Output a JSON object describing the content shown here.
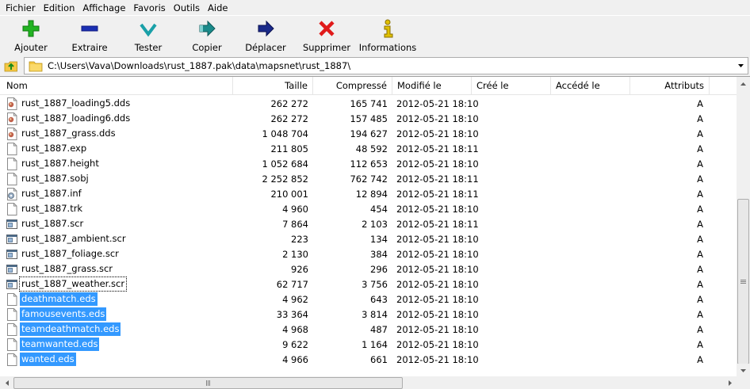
{
  "menu": [
    "Fichier",
    "Edition",
    "Affichage",
    "Favoris",
    "Outils",
    "Aide"
  ],
  "toolbar": [
    {
      "label": "Ajouter",
      "icon": "plus-icon",
      "color": "#22b322"
    },
    {
      "label": "Extraire",
      "icon": "minus-icon",
      "color": "#1a2fb3"
    },
    {
      "label": "Tester",
      "icon": "checkmark-icon",
      "color": "#1aa0a8"
    },
    {
      "label": "Copier",
      "icon": "copy-arrow-icon",
      "color": "#1a8a8a"
    },
    {
      "label": "Déplacer",
      "icon": "move-arrow-icon",
      "color": "#1a2a8a"
    },
    {
      "label": "Supprimer",
      "icon": "delete-x-icon",
      "color": "#e01a1a"
    },
    {
      "label": "Informations",
      "icon": "info-icon",
      "color": "#e0c000"
    }
  ],
  "address": {
    "path": "C:\\Users\\Vava\\Downloads\\rust_1887.pak\\data\\mapsnet\\rust_1887\\"
  },
  "columns": {
    "name": "Nom",
    "size": "Taille",
    "compressed": "Compressé",
    "modified": "Modifié le",
    "created": "Créé le",
    "accessed": "Accédé le",
    "attributes": "Attributs"
  },
  "files": [
    {
      "name": "rust_1887_loading5.dds",
      "size": "262 272",
      "compressed": "165 741",
      "modified": "2012-05-21 18:10",
      "attr": "A",
      "icon": "image-file-icon",
      "selected": false,
      "focused": false
    },
    {
      "name": "rust_1887_loading6.dds",
      "size": "262 272",
      "compressed": "157 485",
      "modified": "2012-05-21 18:10",
      "attr": "A",
      "icon": "image-file-icon",
      "selected": false,
      "focused": false
    },
    {
      "name": "rust_1887_grass.dds",
      "size": "1 048 704",
      "compressed": "194 627",
      "modified": "2012-05-21 18:10",
      "attr": "A",
      "icon": "image-file-icon",
      "selected": false,
      "focused": false
    },
    {
      "name": "rust_1887.exp",
      "size": "211 805",
      "compressed": "48 592",
      "modified": "2012-05-21 18:11",
      "attr": "A",
      "icon": "blank-file-icon",
      "selected": false,
      "focused": false
    },
    {
      "name": "rust_1887.height",
      "size": "1 052 684",
      "compressed": "112 653",
      "modified": "2012-05-21 18:10",
      "attr": "A",
      "icon": "blank-file-icon",
      "selected": false,
      "focused": false
    },
    {
      "name": "rust_1887.sobj",
      "size": "2 252 852",
      "compressed": "762 742",
      "modified": "2012-05-21 18:11",
      "attr": "A",
      "icon": "blank-file-icon",
      "selected": false,
      "focused": false
    },
    {
      "name": "rust_1887.inf",
      "size": "210 001",
      "compressed": "12 894",
      "modified": "2012-05-21 18:11",
      "attr": "A",
      "icon": "settings-file-icon",
      "selected": false,
      "focused": false
    },
    {
      "name": "rust_1887.trk",
      "size": "4 960",
      "compressed": "454",
      "modified": "2012-05-21 18:10",
      "attr": "A",
      "icon": "blank-file-icon",
      "selected": false,
      "focused": false
    },
    {
      "name": "rust_1887.scr",
      "size": "7 864",
      "compressed": "2 103",
      "modified": "2012-05-21 18:11",
      "attr": "A",
      "icon": "screensaver-file-icon",
      "selected": false,
      "focused": false
    },
    {
      "name": "rust_1887_ambient.scr",
      "size": "223",
      "compressed": "134",
      "modified": "2012-05-21 18:10",
      "attr": "A",
      "icon": "screensaver-file-icon",
      "selected": false,
      "focused": false
    },
    {
      "name": "rust_1887_foliage.scr",
      "size": "2 130",
      "compressed": "384",
      "modified": "2012-05-21 18:10",
      "attr": "A",
      "icon": "screensaver-file-icon",
      "selected": false,
      "focused": false
    },
    {
      "name": "rust_1887_grass.scr",
      "size": "926",
      "compressed": "296",
      "modified": "2012-05-21 18:10",
      "attr": "A",
      "icon": "screensaver-file-icon",
      "selected": false,
      "focused": false
    },
    {
      "name": "rust_1887_weather.scr",
      "size": "62 717",
      "compressed": "3 756",
      "modified": "2012-05-21 18:10",
      "attr": "A",
      "icon": "screensaver-file-icon",
      "selected": false,
      "focused": true
    },
    {
      "name": "deathmatch.eds",
      "size": "4 962",
      "compressed": "643",
      "modified": "2012-05-21 18:10",
      "attr": "A",
      "icon": "blank-file-icon",
      "selected": true,
      "focused": false
    },
    {
      "name": "famousevents.eds",
      "size": "33 364",
      "compressed": "3 814",
      "modified": "2012-05-21 18:10",
      "attr": "A",
      "icon": "blank-file-icon",
      "selected": true,
      "focused": false
    },
    {
      "name": "teamdeathmatch.eds",
      "size": "4 968",
      "compressed": "487",
      "modified": "2012-05-21 18:10",
      "attr": "A",
      "icon": "blank-file-icon",
      "selected": true,
      "focused": false
    },
    {
      "name": "teamwanted.eds",
      "size": "9 622",
      "compressed": "1 164",
      "modified": "2012-05-21 18:10",
      "attr": "A",
      "icon": "blank-file-icon",
      "selected": true,
      "focused": false
    },
    {
      "name": "wanted.eds",
      "size": "4 966",
      "compressed": "661",
      "modified": "2012-05-21 18:10",
      "attr": "A",
      "icon": "blank-file-icon",
      "selected": true,
      "focused": false
    }
  ]
}
